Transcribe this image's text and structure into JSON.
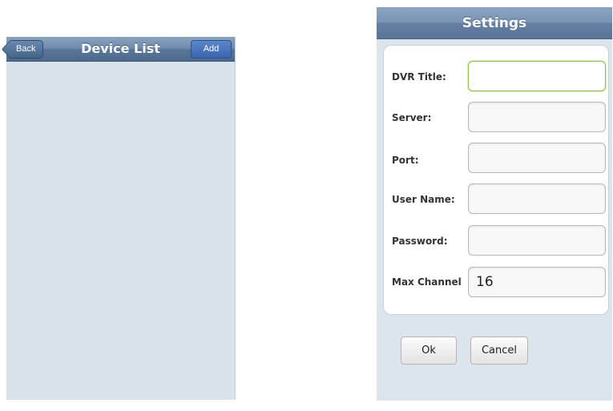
{
  "device_list": {
    "title": "Device List",
    "back_label": "Back",
    "add_label": "Add"
  },
  "settings": {
    "title": "Settings",
    "fields": [
      {
        "label": "DVR Title:",
        "value": ""
      },
      {
        "label": "Server:",
        "value": ""
      },
      {
        "label": "Port:",
        "value": ""
      },
      {
        "label": "User Name:",
        "value": ""
      },
      {
        "label": "Password:",
        "value": ""
      },
      {
        "label": "Max Channel",
        "value": "16"
      }
    ],
    "ok_label": "Ok",
    "cancel_label": "Cancel"
  }
}
